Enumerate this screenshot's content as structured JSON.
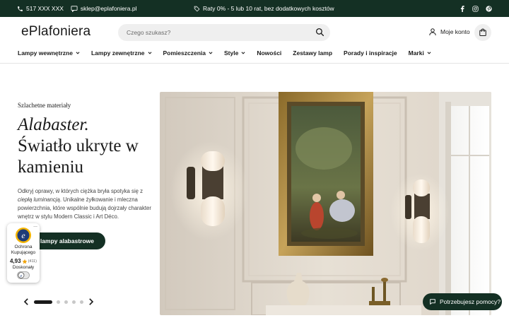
{
  "topbar": {
    "phone": "517 XXX XXX",
    "email": "sklep@eplafoniera.pl",
    "promo": "Raty 0% - 5 lub 10 rat, bez dodatkowych kosztów"
  },
  "header": {
    "logo": "ePlafoniera",
    "search_placeholder": "Czego szukasz?",
    "account_label": "Moje konto"
  },
  "nav": {
    "items": [
      {
        "label": "Lampy wewnętrzne",
        "dropdown": true
      },
      {
        "label": "Lampy zewnętrzne",
        "dropdown": true
      },
      {
        "label": "Pomieszczenia",
        "dropdown": true
      },
      {
        "label": "Style",
        "dropdown": true
      },
      {
        "label": "Nowości",
        "dropdown": false
      },
      {
        "label": "Zestawy lamp",
        "dropdown": false
      },
      {
        "label": "Porady i inspiracje",
        "dropdown": false
      },
      {
        "label": "Marki",
        "dropdown": true
      }
    ]
  },
  "hero": {
    "eyebrow": "Szlachetne materiały",
    "title_italic": "Alabaster.",
    "title_rest": "Światło ukryte w kamieniu",
    "desc_1": "Odkryj oprawy, w których ciężka bryła spotyka się z ",
    "desc_italic": "ciepłą luminancją",
    "desc_2": ". Unikalne żyłkowanie i mleczna powierzchnia, które wspólnie budują dojrzały charakter wnętrz w stylu Modern Classic i Art Déco.",
    "cta": "Odkryj lampy alabastrowe",
    "slides": 5,
    "active_slide": 1
  },
  "badge": {
    "title": "Ochrona Kupującego",
    "score": "4,93",
    "count": "(411)",
    "grade": "Doskonały",
    "more": "..."
  },
  "help": {
    "label": "Potrzebujesz pomocy?"
  },
  "colors": {
    "brand_green": "#143024",
    "search_bg": "#efefef"
  }
}
